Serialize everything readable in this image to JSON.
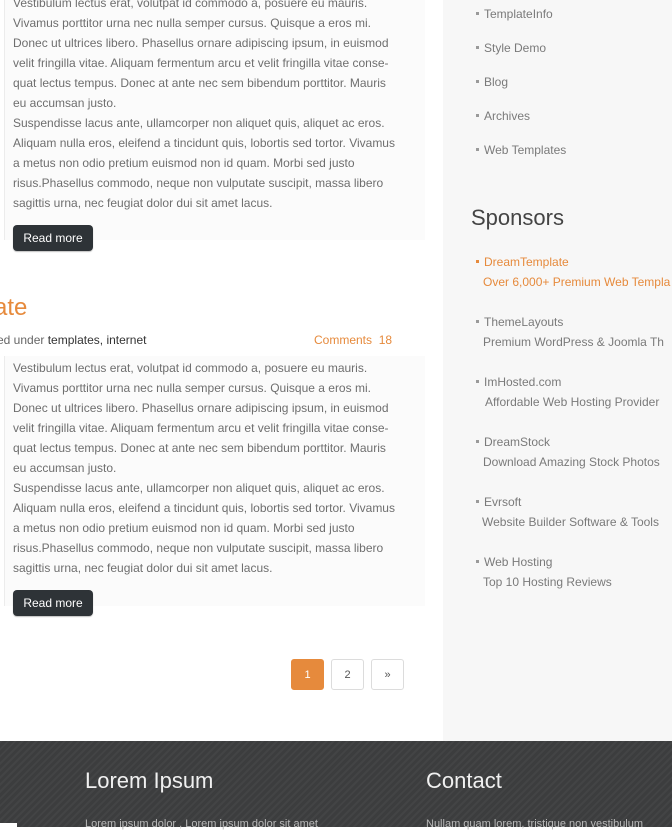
{
  "sidebar": {
    "links": [
      {
        "label": "TemplateInfo"
      },
      {
        "label": "Style Demo"
      },
      {
        "label": "Blog"
      },
      {
        "label": "Archives"
      },
      {
        "label": "Web Templates"
      }
    ],
    "sponsors_title": "Sponsors",
    "sponsors": [
      {
        "name": "DreamTemplate",
        "desc": "Over 6,000+ Premium Web Templa"
      },
      {
        "name": "ThemeLayouts",
        "desc": "Premium WordPress & Joomla Th"
      },
      {
        "name": "ImHosted.com",
        "desc": "Affordable Web Hosting Provider"
      },
      {
        "name": "DreamStock",
        "desc": "Download Amazing Stock Photos"
      },
      {
        "name": "Evrsoft",
        "desc": "Website Builder Software & Tools"
      },
      {
        "name": "Web Hosting",
        "desc": "Top 10 Hosting Reviews"
      }
    ]
  },
  "posts": [
    {
      "para1": "Vestibulum lectus erat, volutpat id commodo a, posuere eu mauris.\nVivamus porttitor urna nec nulla semper cursus. Quisque a eros mi.\nDonec ut ultrices libero. Phasellus ornare adipiscing ipsum, in euismod\nvelit fringilla vitae. Aliquam fermentum arcu et velit fringilla vitae conse-\nquat lectus tempus. Donec at ante nec sem bibendum porttitor. Mauris\neu accumsan justo.",
      "para2": "Suspendisse lacus ante, ullamcorper non aliquet quis, aliquet ac eros.\nAliquam nulla eros, eleifend a tincidunt quis, lobortis sed tortor. Vivamus\na metus non odio pretium euismod non id quam. Morbi sed justo\nrisus.Phasellus commodo, neque non vulputate suscipit, massa libero\nsagittis urna, nec feugiat dolor dui sit amet lacus.",
      "read_more": "Read more"
    },
    {
      "title": "ate",
      "meta_prefix": "ed under",
      "tag1": "templates",
      "sep": ",",
      "tag2": "internet",
      "comments_label": "Comments",
      "comments_count": "18",
      "para1": "Vestibulum lectus erat, volutpat id commodo a, posuere eu mauris.\nVivamus porttitor urna nec nulla semper cursus. Quisque a eros mi.\nDonec ut ultrices libero. Phasellus ornare adipiscing ipsum, in euismod\nvelit fringilla vitae. Aliquam fermentum arcu et velit fringilla vitae conse-\nquat lectus tempus. Donec at ante nec sem bibendum porttitor. Mauris\neu accumsan justo.",
      "para2": "Suspendisse lacus ante, ullamcorper non aliquet quis, aliquet ac eros.\nAliquam nulla eros, eleifend a tincidunt quis, lobortis sed tortor. Vivamus\na metus non odio pretium euismod non id quam. Morbi sed justo\nrisus.Phasellus commodo, neque non vulputate suscipit, massa libero\nsagittis urna, nec feugiat dolor dui sit amet lacus.",
      "read_more": "Read more"
    }
  ],
  "pagination": {
    "pages": [
      "1",
      "2"
    ],
    "next": "»",
    "current": "1"
  },
  "footer": {
    "col1_title": "Lorem Ipsum",
    "col1_text": "Lorem ipsum dolor , Lorem ipsum dolor sit amet",
    "col2_title": "Contact",
    "col2_text": "Nullam quam lorem, tristique non vestibulum"
  },
  "colors": {
    "accent": "#e68a3c",
    "button_dark": "#2e3337",
    "footer_bg": "#3c3d3e"
  }
}
